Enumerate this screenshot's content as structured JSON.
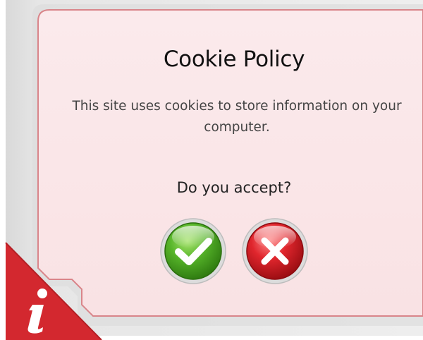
{
  "dialog": {
    "title": "Cookie Policy",
    "message": "This site uses cookies to store information on your computer.",
    "question": "Do you accept?",
    "accept_icon": "checkmark-icon",
    "decline_icon": "x-close-icon",
    "info_icon": "info-icon"
  },
  "colors": {
    "panel_fill": "#fbe9ea",
    "panel_border": "#d9858a",
    "accept_green": "#3f9b1b",
    "decline_red": "#d01e26",
    "info_red": "#d3282f",
    "backdrop_gray": "#e8e8e8"
  }
}
